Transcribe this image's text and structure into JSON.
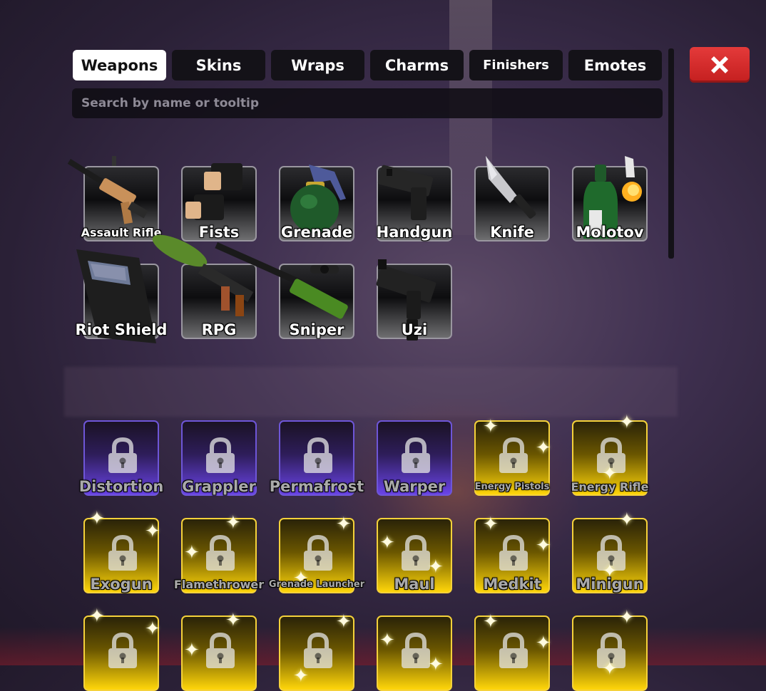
{
  "tabs": [
    {
      "label": "Weapons",
      "active": true
    },
    {
      "label": "Skins",
      "active": false
    },
    {
      "label": "Wraps",
      "active": false
    },
    {
      "label": "Charms",
      "active": false
    },
    {
      "label": "Finishers",
      "active": false
    },
    {
      "label": "Emotes",
      "active": false
    }
  ],
  "close_icon": "x-icon",
  "search": {
    "placeholder": "Search by name or tooltip",
    "value": ""
  },
  "owned_items": [
    {
      "name": "Assault Rifle",
      "icon": "assault-rifle-icon"
    },
    {
      "name": "Fists",
      "icon": "fists-icon"
    },
    {
      "name": "Grenade",
      "icon": "grenade-icon"
    },
    {
      "name": "Handgun",
      "icon": "handgun-icon"
    },
    {
      "name": "Knife",
      "icon": "knife-icon"
    },
    {
      "name": "Molotov",
      "icon": "molotov-icon"
    },
    {
      "name": "Riot Shield",
      "icon": "riot-shield-icon"
    },
    {
      "name": "RPG",
      "icon": "rpg-icon"
    },
    {
      "name": "Sniper",
      "icon": "sniper-icon"
    },
    {
      "name": "Uzi",
      "icon": "uzi-icon"
    }
  ],
  "locked_items": [
    {
      "name": "Distortion",
      "rarity": "purple"
    },
    {
      "name": "Grappler",
      "rarity": "purple"
    },
    {
      "name": "Permafrost",
      "rarity": "purple"
    },
    {
      "name": "Warper",
      "rarity": "purple"
    },
    {
      "name": "Energy Pistols",
      "rarity": "gold"
    },
    {
      "name": "Energy Rifle",
      "rarity": "gold"
    },
    {
      "name": "Exogun",
      "rarity": "gold"
    },
    {
      "name": "Flamethrower",
      "rarity": "gold"
    },
    {
      "name": "Grenade Launcher",
      "rarity": "gold"
    },
    {
      "name": "Maul",
      "rarity": "gold"
    },
    {
      "name": "Medkit",
      "rarity": "gold"
    },
    {
      "name": "Minigun",
      "rarity": "gold"
    },
    {
      "name": "",
      "rarity": "gold"
    },
    {
      "name": "",
      "rarity": "gold"
    },
    {
      "name": "",
      "rarity": "gold"
    },
    {
      "name": "",
      "rarity": "gold"
    },
    {
      "name": "",
      "rarity": "gold"
    },
    {
      "name": "",
      "rarity": "gold"
    }
  ],
  "lock_icon": "padlock-icon",
  "colors": {
    "purple_rarity": "#6a44e8",
    "gold_rarity": "#ffd60a",
    "close_button": "#d42a2a",
    "active_tab": "#ffffff",
    "inactive_tab": "#141218"
  }
}
